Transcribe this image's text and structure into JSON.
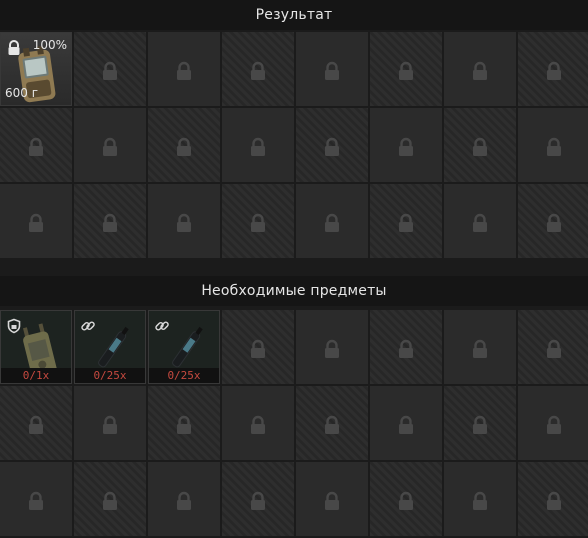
{
  "result_section": {
    "title": "Результат",
    "item": {
      "name": "Tactical radio",
      "durability": "100%",
      "weight": "600 г",
      "icon": "lock-icon"
    }
  },
  "required_section": {
    "title": "Необходимые предметы",
    "items": [
      {
        "name": "Tactical radio",
        "count": "0/1x",
        "icon": "shield-icon"
      },
      {
        "name": "Repair kit",
        "count": "0/25x",
        "icon": "link-icon"
      },
      {
        "name": "Repair kit",
        "count": "0/25x",
        "icon": "link-icon"
      }
    ]
  },
  "colors": {
    "count_missing": "#c5493f",
    "header_bg": "#151515",
    "slot_bg": "#2b2b2b"
  }
}
